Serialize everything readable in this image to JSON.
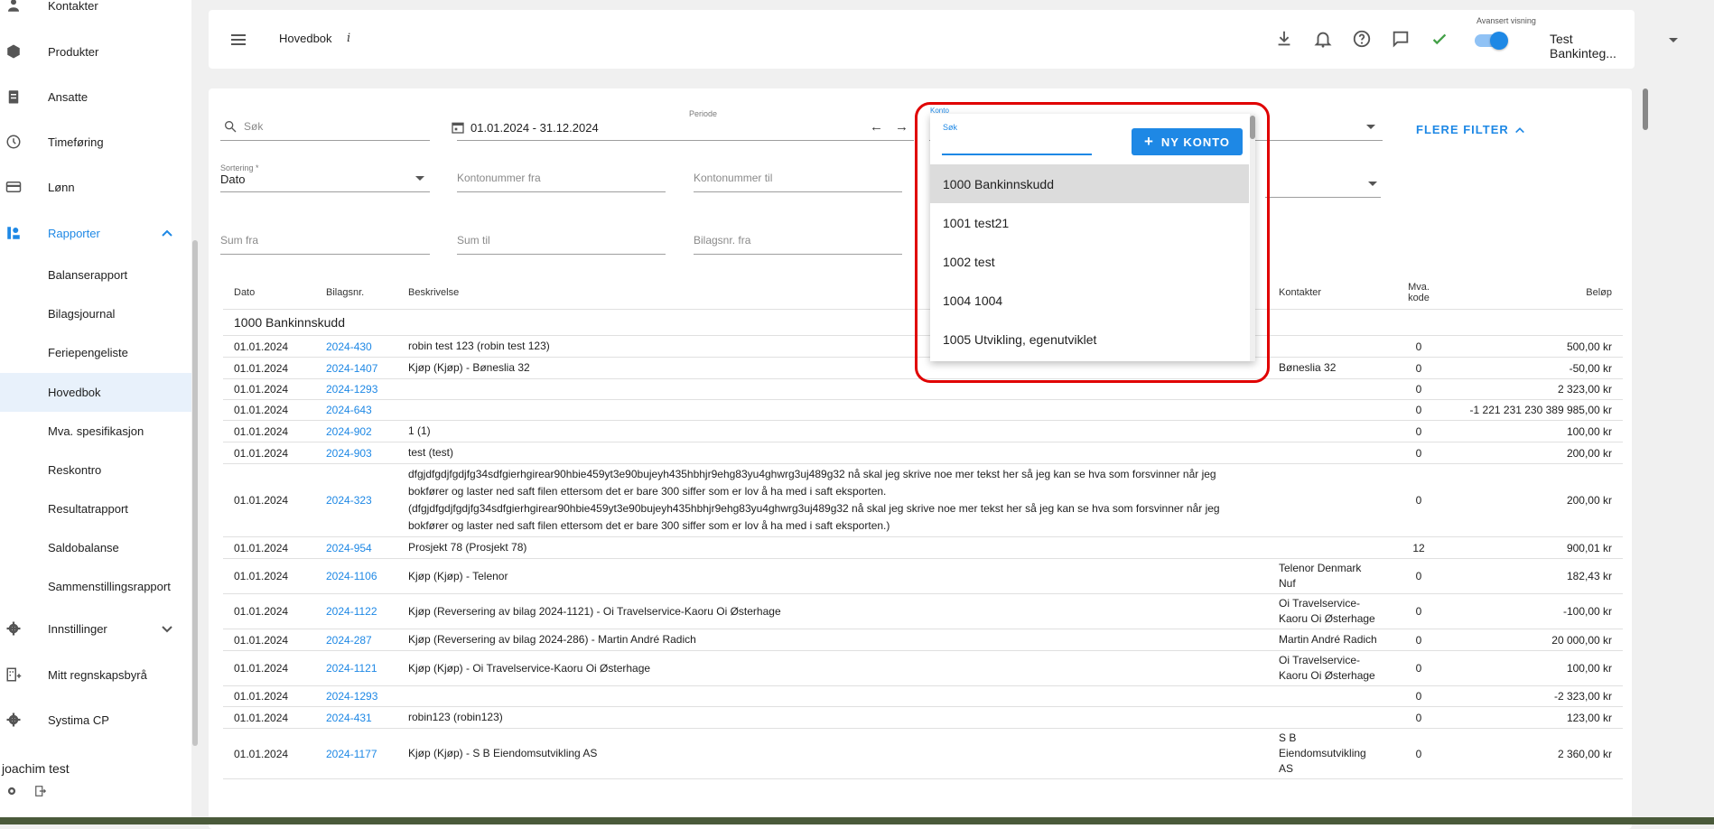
{
  "sidebar": {
    "items": [
      {
        "label": "Kontakter"
      },
      {
        "label": "Produkter"
      },
      {
        "label": "Ansatte"
      },
      {
        "label": "Timeføring"
      },
      {
        "label": "Lønn"
      },
      {
        "label": "Rapporter"
      },
      {
        "label": "Innstillinger"
      },
      {
        "label": "Mitt regnskapsbyrå"
      },
      {
        "label": "Systima CP"
      }
    ],
    "subitems": [
      {
        "label": "Balanserapport"
      },
      {
        "label": "Bilagsjournal"
      },
      {
        "label": "Feriepengeliste"
      },
      {
        "label": "Hovedbok"
      },
      {
        "label": "Mva. spesifikasjon"
      },
      {
        "label": "Reskontro"
      },
      {
        "label": "Resultatrapport"
      },
      {
        "label": "Saldobalanse"
      },
      {
        "label": "Sammenstillingsrapport"
      }
    ],
    "user": "joachim test"
  },
  "header": {
    "title": "Hovedbok",
    "info": "i",
    "advanced_label": "Avansert visning",
    "company": "Test Bankinteg..."
  },
  "filters": {
    "search_placeholder": "Søk",
    "period_label": "Periode",
    "period_value": "01.01.2024 - 31.12.2024",
    "arrow_left": "←",
    "arrow_right": "→",
    "more_filters": "FLERE FILTER",
    "sort_label": "Sortering *",
    "sort_value": "Dato",
    "account_from": "Kontonummer fra",
    "account_to": "Kontonummer til",
    "sum_from": "Sum fra",
    "sum_to": "Sum til",
    "voucher_from": "Bilagsnr. fra"
  },
  "konto_dropdown": {
    "label": "Konto",
    "search_label": "Søk",
    "search_value": "",
    "new_button": "NY KONTO",
    "options": [
      "1000 Bankinnskudd",
      "1001 test21",
      "1002 test",
      "1004 1004",
      "1005 Utvikling, egenutviklet"
    ]
  },
  "table": {
    "headers": {
      "date": "Dato",
      "voucher": "Bilagsnr.",
      "description": "Beskrivelse",
      "contacts": "Kontakter",
      "vat_line1": "Mva.",
      "vat_line2": "kode",
      "amount": "Beløp"
    },
    "group": "1000 Bankinnskudd",
    "rows": [
      {
        "date": "01.01.2024",
        "voucher": "2024-430",
        "desc": "robin test 123 (robin test 123)",
        "contact": "",
        "vat": "0",
        "amount": "500,00 kr"
      },
      {
        "date": "01.01.2024",
        "voucher": "2024-1407",
        "desc": "Kjøp (Kjøp) - Bøneslia 32",
        "contact": "Bøneslia 32",
        "vat": "0",
        "amount": "-50,00 kr"
      },
      {
        "date": "01.01.2024",
        "voucher": "2024-1293",
        "desc": "",
        "contact": "",
        "vat": "0",
        "amount": "2 323,00 kr"
      },
      {
        "date": "01.01.2024",
        "voucher": "2024-643",
        "desc": "",
        "contact": "",
        "vat": "0",
        "amount": "-1 221 231 230 389 985,00 kr"
      },
      {
        "date": "01.01.2024",
        "voucher": "2024-902",
        "desc": "1 (1)",
        "contact": "",
        "vat": "0",
        "amount": "100,00 kr"
      },
      {
        "date": "01.01.2024",
        "voucher": "2024-903",
        "desc": "test (test)",
        "contact": "",
        "vat": "0",
        "amount": "200,00 kr"
      },
      {
        "date": "01.01.2024",
        "voucher": "2024-323",
        "desc": "dfgjdfgdjfgdjfg34sdfgierhgirear90hbie459yt3e90bujeyh435hbhjr9ehg83yu4ghwrg3uj489g32 nå skal jeg skrive noe mer tekst her så jeg kan se hva som forsvinner når jeg bokfører og laster ned saft filen ettersom det er bare 300 siffer som er lov å ha med i saft eksporten. (dfgjdfgdjfgdjfg34sdfgierhgirear90hbie459yt3e90bujeyh435hbhjr9ehg83yu4ghwrg3uj489g32 nå skal jeg skrive noe mer tekst her så jeg kan se hva som forsvinner når jeg bokfører og laster ned saft filen ettersom det er bare 300 siffer som er lov å ha med i saft eksporten.)",
        "contact": "",
        "vat": "0",
        "amount": "200,00 kr"
      },
      {
        "date": "01.01.2024",
        "voucher": "2024-954",
        "desc": "Prosjekt 78 (Prosjekt 78)",
        "contact": "",
        "vat": "12",
        "amount": "900,01 kr"
      },
      {
        "date": "01.01.2024",
        "voucher": "2024-1106",
        "desc": "Kjøp (Kjøp) - Telenor",
        "contact": "Telenor Denmark Nuf",
        "vat": "0",
        "amount": "182,43 kr"
      },
      {
        "date": "01.01.2024",
        "voucher": "2024-1122",
        "desc": "Kjøp (Reversering av bilag 2024-1121) - Oi Travelservice-Kaoru Oi Østerhage",
        "contact": "Oi Travelservice-Kaoru Oi Østerhage",
        "vat": "0",
        "amount": "-100,00 kr"
      },
      {
        "date": "01.01.2024",
        "voucher": "2024-287",
        "desc": "Kjøp (Reversering av bilag 2024-286) - Martin André Radich",
        "contact": "Martin André Radich",
        "vat": "0",
        "amount": "20 000,00 kr"
      },
      {
        "date": "01.01.2024",
        "voucher": "2024-1121",
        "desc": "Kjøp (Kjøp) - Oi Travelservice-Kaoru Oi Østerhage",
        "contact": "Oi Travelservice-Kaoru Oi Østerhage",
        "vat": "0",
        "amount": "100,00 kr"
      },
      {
        "date": "01.01.2024",
        "voucher": "2024-1293",
        "desc": "",
        "contact": "",
        "vat": "0",
        "amount": "-2 323,00 kr"
      },
      {
        "date": "01.01.2024",
        "voucher": "2024-431",
        "desc": "robin123 (robin123)",
        "contact": "",
        "vat": "0",
        "amount": "123,00 kr"
      },
      {
        "date": "01.01.2024",
        "voucher": "2024-1177",
        "desc": "Kjøp (Kjøp) - S B Eiendomsutvikling AS",
        "contact": "S B Eiendomsutvikling AS",
        "vat": "0",
        "amount": "2 360,00 kr"
      }
    ]
  },
  "colors": {
    "accent": "#1e88e5",
    "highlight": "#e00000",
    "active_nav": "#e8f1fb"
  }
}
